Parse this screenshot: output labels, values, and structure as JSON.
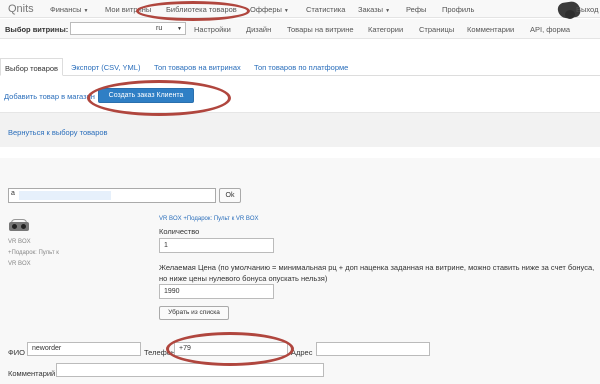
{
  "topbar": {
    "brand": "Qnits",
    "items": [
      {
        "label": "Финансы",
        "dropdown": true
      },
      {
        "label": "Мои витрины",
        "dropdown": false
      },
      {
        "label": "Библиотека товаров",
        "dropdown": false
      },
      {
        "label": "Офферы",
        "dropdown": true
      },
      {
        "label": "Статистика",
        "dropdown": false
      },
      {
        "label": "Заказы",
        "dropdown": true
      },
      {
        "label": "Рефы",
        "dropdown": false
      },
      {
        "label": "Профиль",
        "dropdown": false
      }
    ],
    "logout": "Выход"
  },
  "subbar": {
    "label": "Выбор витрины:",
    "select_value": "ru",
    "items": [
      "Настройки",
      "Дизайн",
      "Товары на витрине",
      "Категории",
      "Страницы",
      "Комментарии",
      "API, форма"
    ]
  },
  "tabs": [
    "Выбор товаров",
    "Экспорт (CSV, YML)",
    "Топ товаров на витринах",
    "Топ товаров по платформе"
  ],
  "actions": {
    "add_link": "Добавить товар в магазин",
    "create_order_button": "Создать заказ Клиента"
  },
  "back_link": "Вернуться к выбору товаров",
  "search": {
    "value": "a",
    "ok_label": "Ok"
  },
  "product": {
    "side_lines": [
      "VR BOX",
      "+Подарок: Пульт к",
      "VR BOX"
    ],
    "link": "VR BOX +Подарок: Пульт к VR BOX",
    "qty_label": "Количество",
    "qty_value": "1",
    "price_note": "Желаемая Цена (по умолчанию = минимальная рц + доп наценка заданная на витрине, можно ставить ниже за счет бонуса, но ниже цены нулевого бонуса опускать нельзя)",
    "price_value": "1990",
    "remove_label": "Убрать из списка"
  },
  "order": {
    "fio_label": "ФИО",
    "fio_value": "neworder",
    "phone_label": "Телефон",
    "phone_value": "+79",
    "address_label": "Адрес",
    "address_value": "",
    "comment_label": "Комментарий",
    "comment_value": ""
  },
  "colors": {
    "link": "#2a6ebb",
    "primary_button": "#2f7fc5",
    "annotation": "#b0463e"
  }
}
